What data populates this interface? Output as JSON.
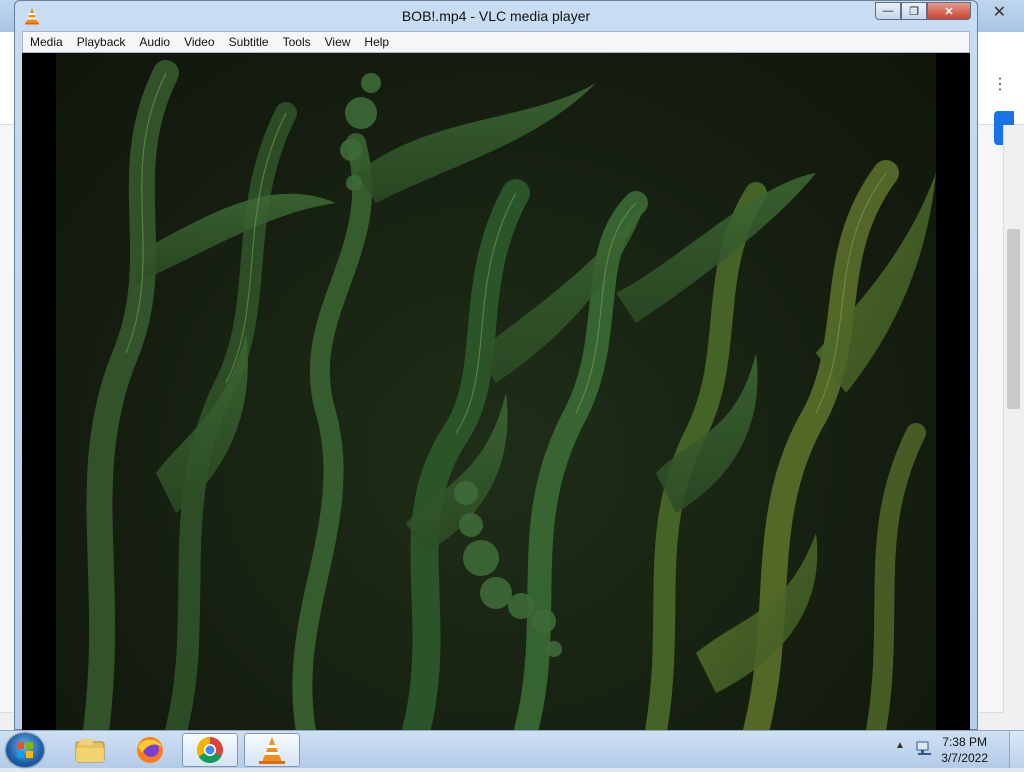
{
  "vlc": {
    "title": "BOB!.mp4 - VLC media player",
    "controls": {
      "minimize": "—",
      "maximize": "❐",
      "close": "✕"
    },
    "menu": [
      "Media",
      "Playback",
      "Audio",
      "Video",
      "Subtitle",
      "Tools",
      "View",
      "Help"
    ]
  },
  "background_browser": {
    "close_glyph": "✕",
    "menu_glyph": "⋮"
  },
  "taskbar": {
    "time": "7:38 PM",
    "date": "3/7/2022",
    "tray_arrow": "▲",
    "pinned": [
      "windows-explorer-icon",
      "firefox-icon",
      "chrome-icon",
      "vlc-icon"
    ]
  },
  "colors": {
    "vlc_orange": "#f28c1b",
    "close_red": "#c8432d",
    "chrome_blue": "#1a73e8"
  }
}
